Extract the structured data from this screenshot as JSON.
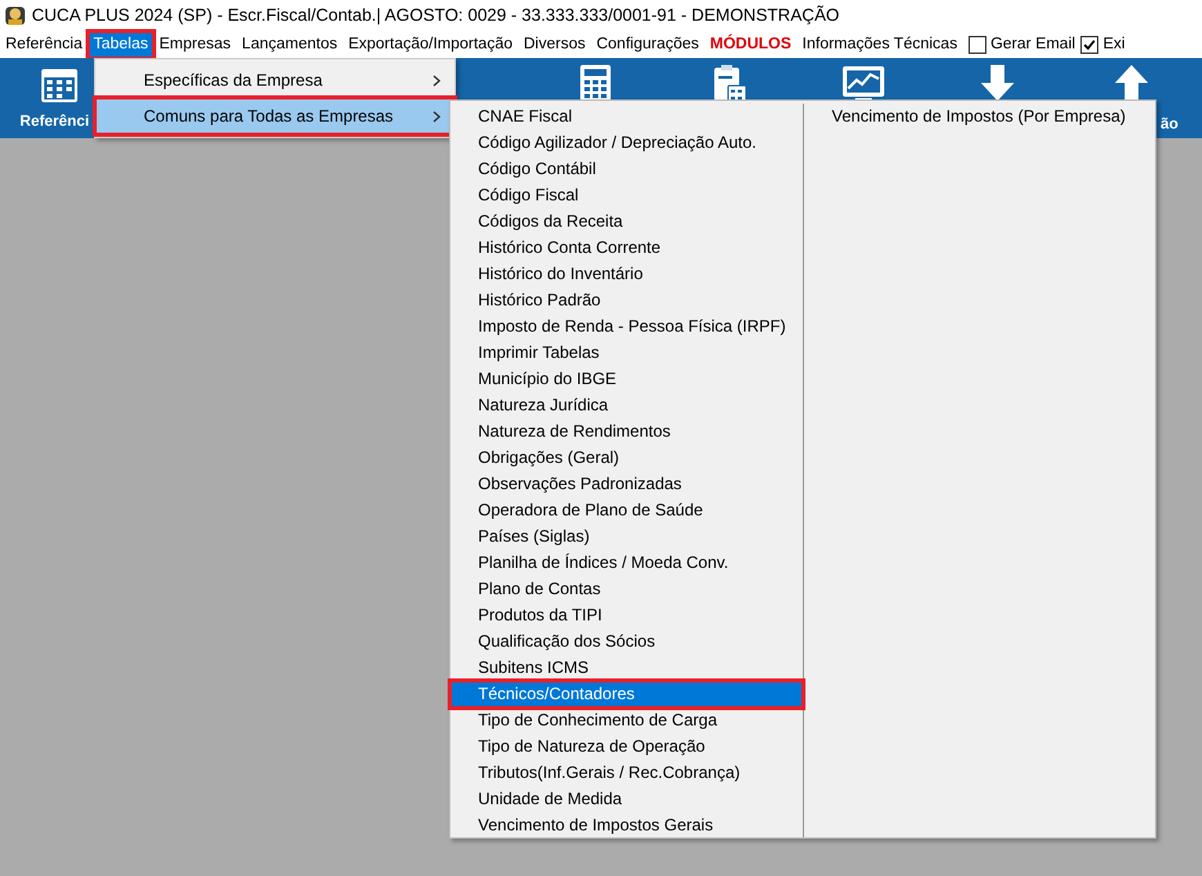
{
  "window": {
    "title": "CUCA PLUS 2024 (SP) - Escr.Fiscal/Contab.| AGOSTO: 0029 - 33.333.333/0001-91 - DEMONSTRAÇÃO"
  },
  "menubar": [
    {
      "kind": "menu",
      "label": "Referência",
      "selected": false,
      "annotated": false
    },
    {
      "kind": "menu",
      "label": "Tabelas",
      "selected": true,
      "annotated": true
    },
    {
      "kind": "menu",
      "label": "Empresas",
      "selected": false,
      "annotated": false
    },
    {
      "kind": "menu",
      "label": "Lançamentos",
      "selected": false,
      "annotated": false
    },
    {
      "kind": "menu",
      "label": "Exportação/Importação",
      "selected": false,
      "annotated": false
    },
    {
      "kind": "menu",
      "label": "Diversos",
      "selected": false,
      "annotated": false
    },
    {
      "kind": "menu",
      "label": "Configurações",
      "selected": false,
      "annotated": false
    },
    {
      "kind": "alert",
      "label": "MÓDULOS",
      "selected": false,
      "annotated": false
    },
    {
      "kind": "menu",
      "label": "Informações Técnicas",
      "selected": false,
      "annotated": false
    },
    {
      "kind": "checkbox",
      "label": "Gerar Email",
      "checked": false
    },
    {
      "kind": "checkbox",
      "label": "Exi",
      "checked": true
    }
  ],
  "toolbar": {
    "first_label": "Referênci",
    "last_label": "ão"
  },
  "dropdown": [
    {
      "label": "Específicas da Empresa",
      "selected": false,
      "annotated": false
    },
    {
      "label": "Comuns para Todas as Empresas",
      "selected": true,
      "annotated": true
    }
  ],
  "submenu": {
    "column_1": [
      {
        "label": "CNAE Fiscal",
        "selected": false,
        "annotated": false
      },
      {
        "label": "Código Agilizador / Depreciação Auto.",
        "selected": false,
        "annotated": false
      },
      {
        "label": "Código Contábil",
        "selected": false,
        "annotated": false
      },
      {
        "label": "Código Fiscal",
        "selected": false,
        "annotated": false
      },
      {
        "label": "Códigos da Receita",
        "selected": false,
        "annotated": false
      },
      {
        "label": "Histórico Conta Corrente",
        "selected": false,
        "annotated": false
      },
      {
        "label": "Histórico do Inventário",
        "selected": false,
        "annotated": false
      },
      {
        "label": "Histórico Padrão",
        "selected": false,
        "annotated": false
      },
      {
        "label": "Imposto de Renda - Pessoa Física (IRPF)",
        "selected": false,
        "annotated": false
      },
      {
        "label": "Imprimir Tabelas",
        "selected": false,
        "annotated": false
      },
      {
        "label": "Município do IBGE",
        "selected": false,
        "annotated": false
      },
      {
        "label": "Natureza Jurídica",
        "selected": false,
        "annotated": false
      },
      {
        "label": "Natureza de Rendimentos",
        "selected": false,
        "annotated": false
      },
      {
        "label": "Obrigações (Geral)",
        "selected": false,
        "annotated": false
      },
      {
        "label": "Observações Padronizadas",
        "selected": false,
        "annotated": false
      },
      {
        "label": "Operadora de Plano de Saúde",
        "selected": false,
        "annotated": false
      },
      {
        "label": "Países (Siglas)",
        "selected": false,
        "annotated": false
      },
      {
        "label": "Planilha de Índices / Moeda Conv.",
        "selected": false,
        "annotated": false
      },
      {
        "label": "Plano de Contas",
        "selected": false,
        "annotated": false
      },
      {
        "label": "Produtos da TIPI",
        "selected": false,
        "annotated": false
      },
      {
        "label": "Qualificação dos Sócios",
        "selected": false,
        "annotated": false
      },
      {
        "label": "Subitens ICMS",
        "selected": false,
        "annotated": false
      },
      {
        "label": "Técnicos/Contadores",
        "selected": true,
        "annotated": true
      },
      {
        "label": "Tipo de Conhecimento de Carga",
        "selected": false,
        "annotated": false
      },
      {
        "label": "Tipo de Natureza de Operação",
        "selected": false,
        "annotated": false
      },
      {
        "label": "Tributos(Inf.Gerais / Rec.Cobrança)",
        "selected": false,
        "annotated": false
      },
      {
        "label": "Unidade de Medida",
        "selected": false,
        "annotated": false
      },
      {
        "label": "Vencimento de Impostos Gerais",
        "selected": false,
        "annotated": false
      }
    ],
    "column_2": [
      {
        "label": "Vencimento de Impostos (Por Empresa)",
        "selected": false,
        "annotated": false
      }
    ]
  }
}
